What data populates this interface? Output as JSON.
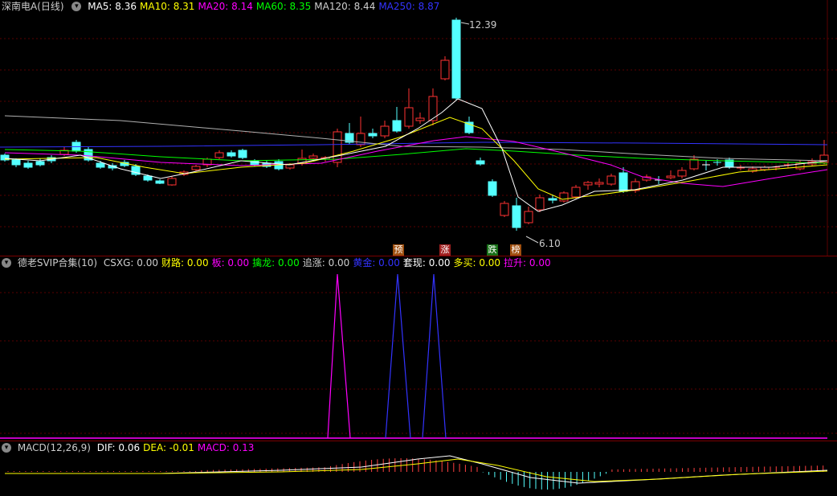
{
  "main": {
    "title": "深南电A(日线)",
    "indicators": [
      {
        "label": "MA5:",
        "value": "8.36",
        "color": "#ffffff"
      },
      {
        "label": "MA10:",
        "value": "8.31",
        "color": "#ffff00"
      },
      {
        "label": "MA20:",
        "value": "8.14",
        "color": "#ff00ff"
      },
      {
        "label": "MA60:",
        "value": "8.35",
        "color": "#00ff00"
      },
      {
        "label": "MA120:",
        "value": "8.44",
        "color": "#cfcfcf"
      },
      {
        "label": "MA250:",
        "value": "8.87",
        "color": "#3333ff"
      }
    ],
    "high_label": "12.39",
    "low_label": "6.10",
    "signals": [
      {
        "text": "预",
        "color": "#c07020"
      },
      {
        "text": "涨",
        "color": "#c03030"
      },
      {
        "text": "跌",
        "color": "#208020"
      },
      {
        "text": "榜",
        "color": "#c07020"
      }
    ]
  },
  "sub1": {
    "title": "德老SVIP合集(10)",
    "indicators": [
      {
        "label": "CSXG:",
        "value": "0.00",
        "color": "#cfcfcf"
      },
      {
        "label": "财路:",
        "value": "0.00",
        "color": "#ffff00"
      },
      {
        "label": "板:",
        "value": "0.00",
        "color": "#ff00ff"
      },
      {
        "label": "擒龙:",
        "value": "0.00",
        "color": "#00ff00"
      },
      {
        "label": "追涨:",
        "value": "0.00",
        "color": "#cfcfcf"
      },
      {
        "label": "黄金:",
        "value": "0.00",
        "color": "#3333ff"
      },
      {
        "label": "套现:",
        "value": "0.00",
        "color": "#ffffff"
      },
      {
        "label": "多买:",
        "value": "0.00",
        "color": "#ffff00"
      },
      {
        "label": "拉升:",
        "value": "0.00",
        "color": "#ff00ff"
      }
    ]
  },
  "sub2": {
    "title": "MACD(12,26,9)",
    "indicators": [
      {
        "label": "DIF:",
        "value": "0.06",
        "color": "#ffffff"
      },
      {
        "label": "DEA:",
        "value": "-0.01",
        "color": "#ffff00"
      },
      {
        "label": "MACD:",
        "value": "0.13",
        "color": "#ff00ff"
      }
    ]
  },
  "chart_data": {
    "type": "candlestick",
    "price_high": 12.39,
    "price_low": 6.1,
    "signal_pulses": [
      {
        "series": "板",
        "color": "#ff00ff"
      },
      {
        "series": "黄金",
        "color": "#3333ff"
      },
      {
        "series": "黄金",
        "color": "#3333ff"
      }
    ]
  }
}
